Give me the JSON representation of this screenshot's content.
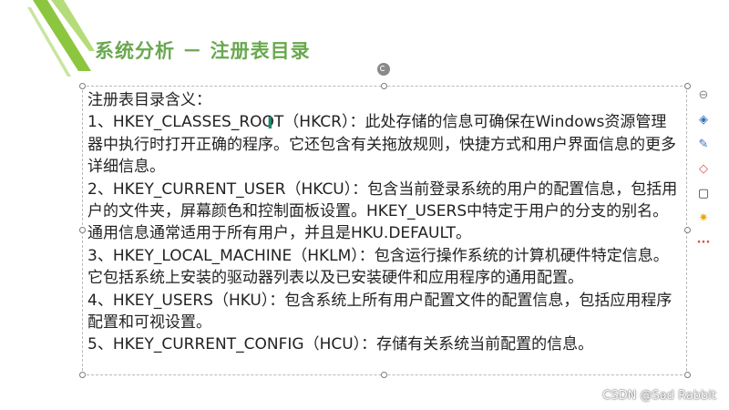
{
  "slide": {
    "title": "系统分析 － 注册表目录",
    "colors": {
      "accent": "#6aa84f",
      "accent_dark": "#4a8a2f"
    },
    "paragraphs": [
      "注册表目录含义：",
      "1、HKEY_CLASSES_ROOT（HKCR）：此处存储的信息可确保在Windows资源管理器中执行时打开正确的程序。它还包含有关拖放规则，快捷方式和用户界面信息的更多详细信息。",
      "2、HKEY_CURRENT_USER（HKCU）：包含当前登录系统的用户的配置信息，包括用户的文件夹，屏幕颜色和控制面板设置。HKEY_USERS中特定于用户的分支的别名。通用信息通常适用于所有用户，并且是HKU.DEFAULT。",
      "3、HKEY_LOCAL_MACHINE（HKLM）：包含运行操作系统的计算机硬件特定信息。它包括系统上安装的驱动器列表以及已安装硬件和应用程序的通用配置。",
      "4、HKEY_USERS（HKU）：包含系统上所有用户配置文件的配置信息，包括应用程序配置和可视设置。",
      "5、HKEY_CURRENT_CONFIG（HCU）：存储有关系统当前配置的信息。"
    ]
  },
  "toolbar": {
    "items": [
      {
        "icon": "collapse-icon",
        "glyph": "⊖"
      },
      {
        "icon": "layers-icon",
        "glyph": "◈"
      },
      {
        "icon": "pen-icon",
        "glyph": "✎"
      },
      {
        "icon": "fill-icon",
        "glyph": "◇"
      },
      {
        "icon": "border-icon",
        "glyph": "▢"
      },
      {
        "icon": "animation-icon",
        "glyph": "✷"
      },
      {
        "icon": "more-icon",
        "glyph": "···"
      }
    ]
  },
  "watermark": "CSDN @Sad Rabbit"
}
